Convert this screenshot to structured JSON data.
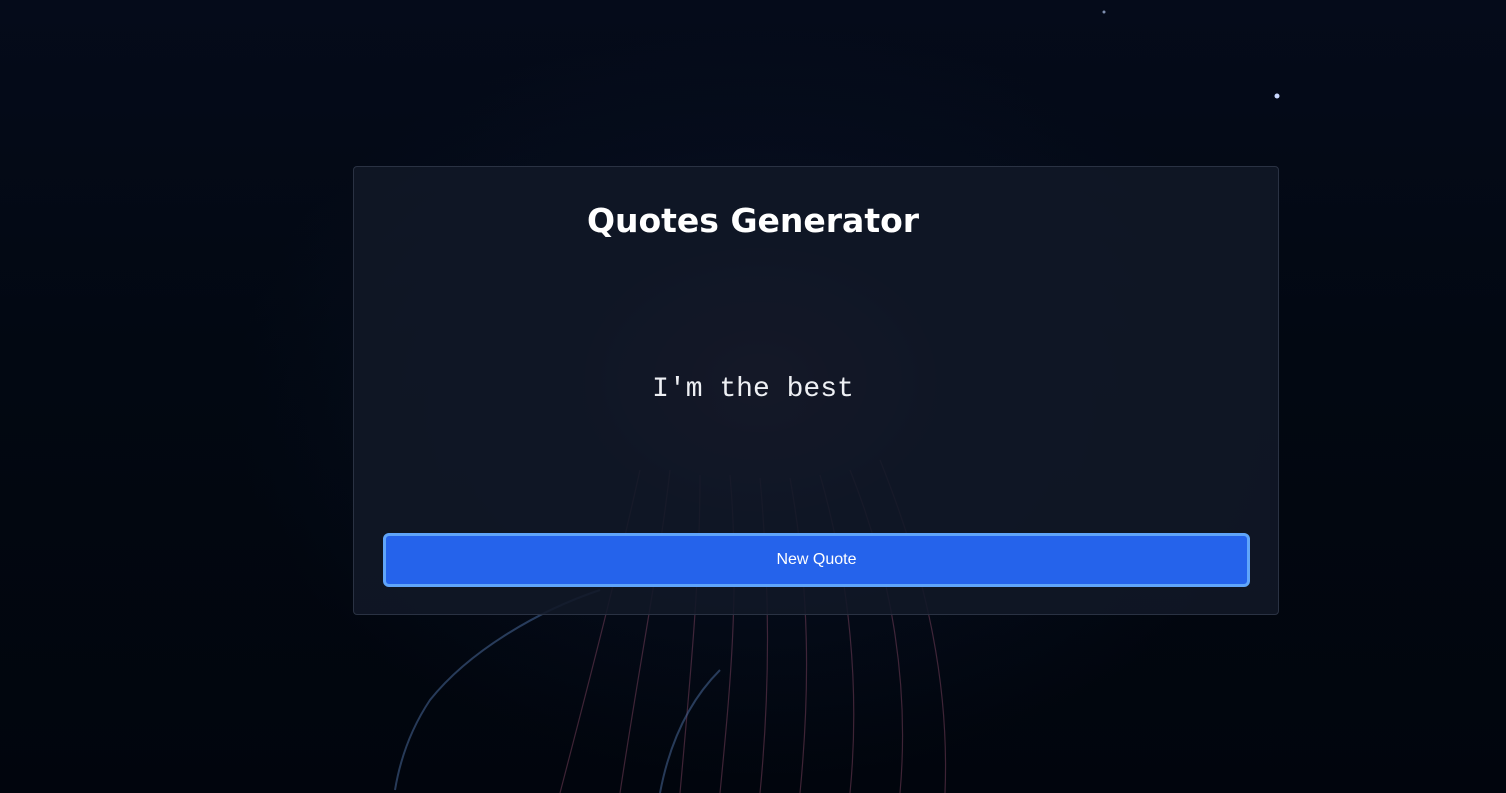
{
  "app": {
    "title": "Quotes Generator"
  },
  "quote": {
    "text": "I'm the best"
  },
  "actions": {
    "new_quote_label": "New Quote"
  },
  "colors": {
    "background": "#020711",
    "card": "#111827",
    "card_border": "#2a3243",
    "button": "#2563eb",
    "button_focus_ring": "#60a5fa",
    "text": "#ffffff"
  }
}
